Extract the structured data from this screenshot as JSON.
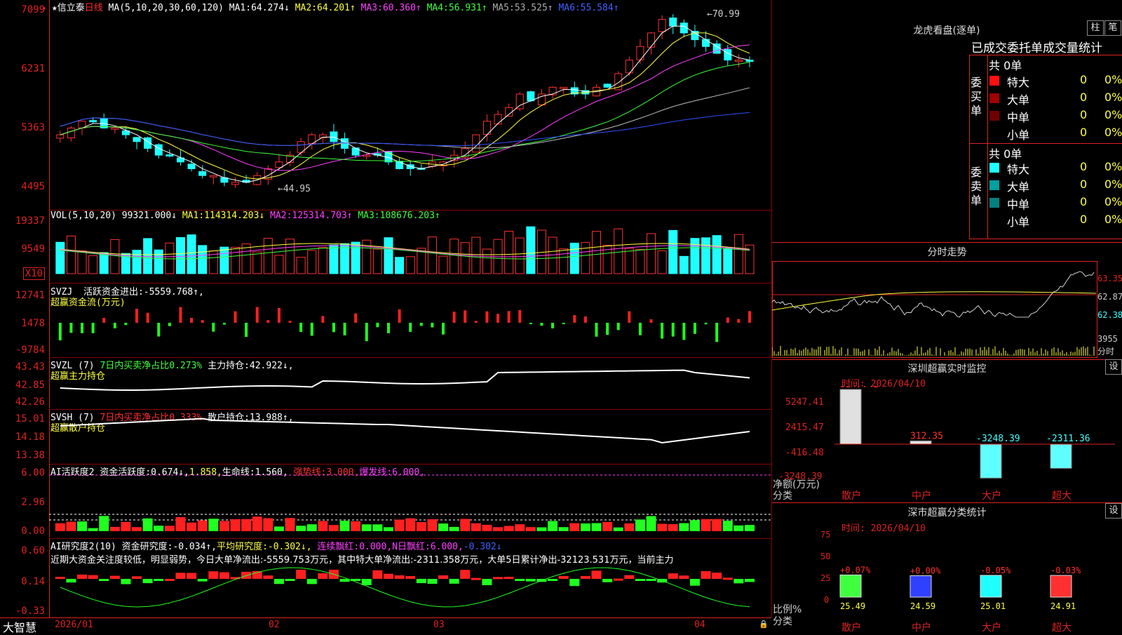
{
  "stock": {
    "star": "★",
    "name": "信立泰",
    "period": "日线"
  },
  "ma": {
    "label": "MA(5,10,20,30,60,120)",
    "items": [
      {
        "k": "MA1:",
        "v": "64.274↓",
        "c": "#ffffff"
      },
      {
        "k": "MA2:",
        "v": "64.201↑",
        "c": "#ffff40"
      },
      {
        "k": "MA3:",
        "v": "60.360↑",
        "c": "#ff40ff"
      },
      {
        "k": "MA4:",
        "v": "56.931↑",
        "c": "#40ff40"
      },
      {
        "k": "MA5:",
        "v": "53.525↑",
        "c": "#cccccc"
      },
      {
        "k": "MA6:",
        "v": "55.584↑",
        "c": "#3050ff"
      }
    ]
  },
  "price_axis": [
    "7099",
    "6231",
    "5363",
    "4495"
  ],
  "price_marks": {
    "high": "70.99",
    "low": "44.95"
  },
  "vol": {
    "label": "VOL(5,10,20)",
    "value": "99321.000↓",
    "items": [
      {
        "k": "MA1:",
        "v": "114314.203↓",
        "c": "#ffff40"
      },
      {
        "k": "MA2:",
        "v": "125314.703↑",
        "c": "#ff40ff"
      },
      {
        "k": "MA3:",
        "v": "108676.203↑",
        "c": "#40ff40"
      }
    ],
    "axis": [
      "19337",
      "9549"
    ],
    "unit": "X10"
  },
  "svzj": {
    "label": "SVZJ",
    "text": "活跃资金进出:",
    "value": "-5559.768↑,",
    "line2": "超赢资金流(万元)",
    "axis": [
      "12741",
      "1478",
      "-9784"
    ]
  },
  "svzl": {
    "label": "SVZL (7)",
    "text1": "7日内买卖净占比0.273%",
    "text2": "主力持仓:",
    "value": "42.922↓,",
    "line2": "超赢主力持仓",
    "axis": [
      "43.43",
      "42.85",
      "42.26"
    ]
  },
  "svsh": {
    "label": "SVSH (7)",
    "text1": "7日内买卖净占比0.333%",
    "text2": "散户持仓:",
    "value": "13.988↑,",
    "line2": "超赢散户持仓",
    "axis": [
      "15.01",
      "14.18",
      "13.38"
    ]
  },
  "ai1": {
    "label": "AI活跃度2",
    "t1": "资金活跃度:",
    "v1": "0.674↓,",
    "v2": "1.858,",
    "t2": "生命线:",
    "v3": "1.560,",
    "t3": "强势线:",
    "v4": "3.000,",
    "t4": "爆发线:",
    "v5": "6.000,",
    "axis": [
      "6.00",
      "2.96",
      "0.00"
    ]
  },
  "ai2": {
    "label": "AI研究度2(10)",
    "t1": "资金研究度:",
    "v1": "-0.034↑,",
    "t2": "平均研究度:",
    "v2": "-0.302↓,",
    "t3": "连续飘红:",
    "v3": "0.000,",
    "t4": "N日飘红:",
    "v4": "6.000,",
    "v5": "-0.302↓",
    "comment": "近期大资金关注度较低，明显弱势，今日大单净流出:-5559.753万元，其中特大单净流出:-2311.358万元，大单5日累计净出-32123.531万元，当前主力",
    "axis": [
      "0.60",
      "0.14",
      "-0.33"
    ]
  },
  "xaxis": {
    "brand": "大智慧",
    "dates": [
      "2026/01",
      "02",
      "03",
      "04"
    ]
  },
  "lhb": {
    "title": "龙虎看盘(逐单)",
    "btn1": "柱",
    "btn2": "笔",
    "tabs": "已成交委托单成交量统计",
    "buy": {
      "label": "委买单",
      "total": "共 0单",
      "rows": [
        {
          "n": "特大",
          "v": "0",
          "p": "0%",
          "c": "#ff1010"
        },
        {
          "n": "大单",
          "v": "0",
          "p": "0%",
          "c": "#a00000"
        },
        {
          "n": "中单",
          "v": "0",
          "p": "0%",
          "c": "#700000"
        },
        {
          "n": "小单",
          "v": "0",
          "p": "0%",
          "c": "#000"
        }
      ]
    },
    "sell": {
      "label": "委卖单",
      "total": "共 0单",
      "rows": [
        {
          "n": "特大",
          "v": "0",
          "p": "0%",
          "c": "#20ffff"
        },
        {
          "n": "大单",
          "v": "0",
          "p": "0%",
          "c": "#00a0a0"
        },
        {
          "n": "中单",
          "v": "0",
          "p": "0%",
          "c": "#008080"
        },
        {
          "n": "小单",
          "v": "0",
          "p": "0%",
          "c": "#000"
        }
      ]
    }
  },
  "fenshi": {
    "title": "分时走势",
    "prices": [
      "63.35",
      "62.87",
      "62.38"
    ],
    "vol": "3955",
    "unit": "分时"
  },
  "szjk": {
    "title": "深圳超赢实时监控",
    "btn": "设",
    "time": "时间: 2026/04/10",
    "axis": [
      "5247.41",
      "2415.47",
      "-416.48",
      "-3248.39"
    ],
    "ylabel": "净额(万元)",
    "xlabel": "分类",
    "cats": [
      "散户",
      "中户",
      "大户",
      "超大"
    ],
    "values": [
      "5247.41",
      "312.35",
      "-3248.39",
      "-2311.36"
    ]
  },
  "scfl": {
    "title": "深市超赢分类统计",
    "btn": "设",
    "time": "时间: 2026/04/10",
    "axis": [
      "75",
      "50",
      "25",
      "0"
    ],
    "ylabel": "比例%",
    "xlabel": "分类",
    "cats": [
      "散户",
      "中户",
      "大户",
      "超大"
    ],
    "pct": [
      "+0.07%",
      "+0.00%",
      "-0.05%",
      "-0.03%"
    ],
    "values": [
      "25.49",
      "24.59",
      "25.01",
      "24.91"
    ]
  },
  "chart_data": {
    "type": "candlestick",
    "series": [
      {
        "name": "MA1",
        "values": [
          64.274
        ]
      },
      {
        "name": "MA2",
        "values": [
          64.201
        ]
      },
      {
        "name": "MA3",
        "values": [
          60.36
        ]
      },
      {
        "name": "MA4",
        "values": [
          56.931
        ]
      },
      {
        "name": "MA5",
        "values": [
          53.525
        ]
      },
      {
        "name": "MA6",
        "values": [
          55.584
        ]
      }
    ],
    "high": 70.99,
    "low": 44.95
  }
}
